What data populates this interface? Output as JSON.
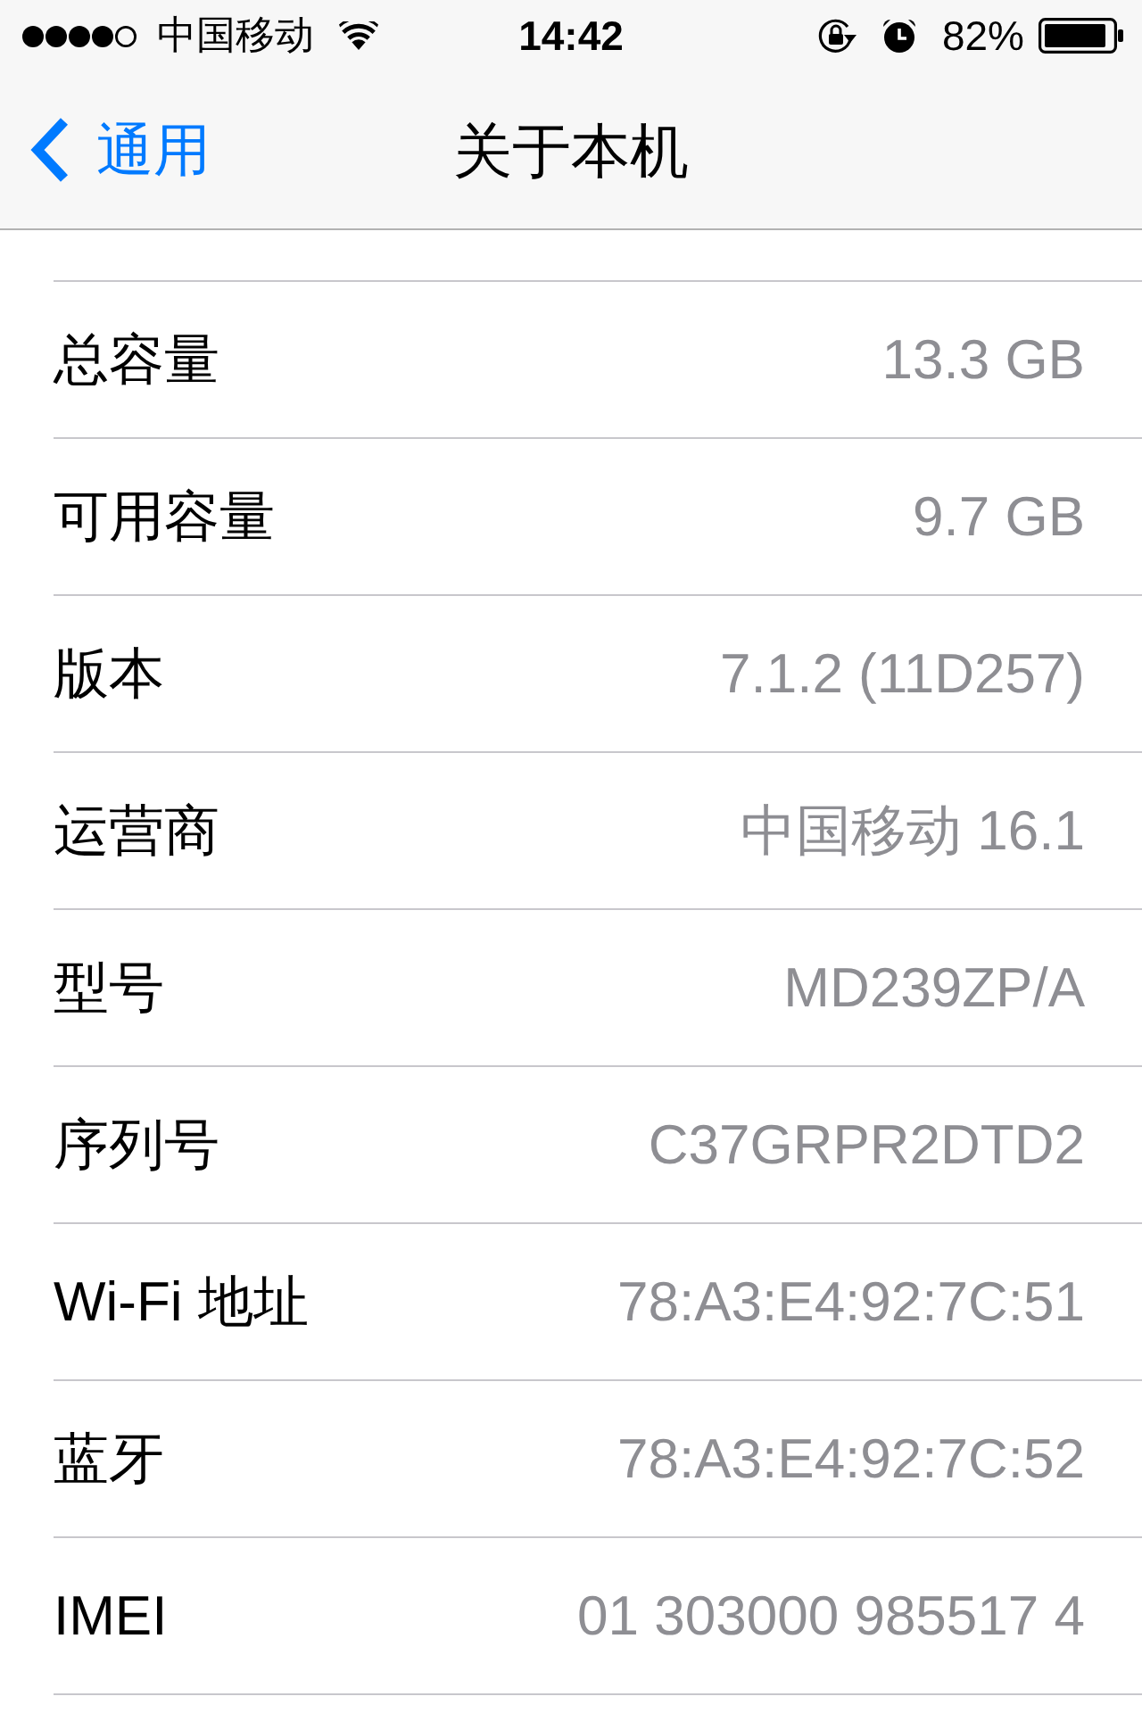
{
  "status_bar": {
    "carrier": "中国移动",
    "time": "14:42",
    "battery": "82%"
  },
  "nav_bar": {
    "back_label": "通用",
    "title": "关于本机"
  },
  "rows": [
    {
      "label": "总容量",
      "value": "13.3 GB"
    },
    {
      "label": "可用容量",
      "value": "9.7 GB"
    },
    {
      "label": "版本",
      "value": "7.1.2 (11D257)"
    },
    {
      "label": "运营商",
      "value": "中国移动 16.1"
    },
    {
      "label": "型号",
      "value": "MD239ZP/A"
    },
    {
      "label": "序列号",
      "value": "C37GRPR2DTD2"
    },
    {
      "label": "Wi-Fi 地址",
      "value": "78:A3:E4:92:7C:51"
    },
    {
      "label": "蓝牙",
      "value": "78:A3:E4:92:7C:52"
    },
    {
      "label": "IMEI",
      "value": "01 303000 985517 4"
    }
  ]
}
